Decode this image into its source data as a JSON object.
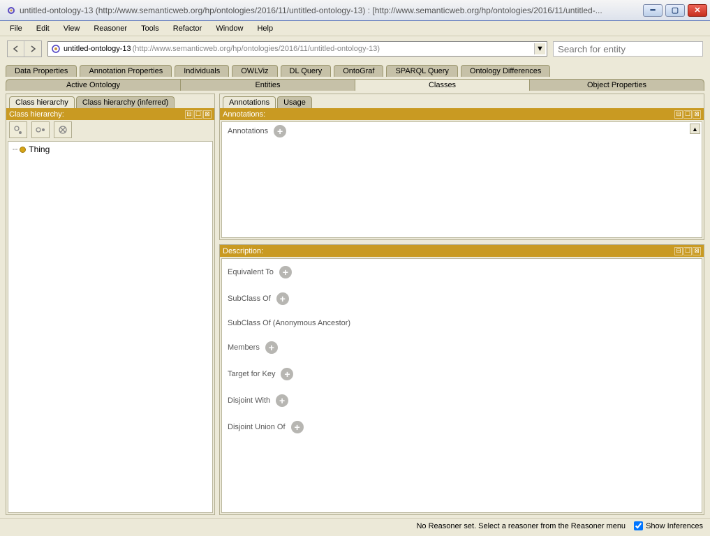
{
  "window": {
    "title": "untitled-ontology-13 (http://www.semanticweb.org/hp/ontologies/2016/11/untitled-ontology-13)  :  [http://www.semanticweb.org/hp/ontologies/2016/11/untitled-..."
  },
  "menu": {
    "items": [
      "File",
      "Edit",
      "View",
      "Reasoner",
      "Tools",
      "Refactor",
      "Window",
      "Help"
    ]
  },
  "toolbar": {
    "ontology_main": "untitled-ontology-13",
    "ontology_sub": "(http://www.semanticweb.org/hp/ontologies/2016/11/untitled-ontology-13)",
    "search_placeholder": "Search for entity"
  },
  "tabs_row1": [
    "Data Properties",
    "Annotation Properties",
    "Individuals",
    "OWLViz",
    "DL Query",
    "OntoGraf",
    "SPARQL Query",
    "Ontology Differences"
  ],
  "tabs_row2": [
    {
      "label": "Active Ontology",
      "active": false
    },
    {
      "label": "Entities",
      "active": false
    },
    {
      "label": "Classes",
      "active": true
    },
    {
      "label": "Object Properties",
      "active": false
    }
  ],
  "left": {
    "subtabs": [
      {
        "label": "Class hierarchy",
        "active": true
      },
      {
        "label": "Class hierarchy (inferred)",
        "active": false
      }
    ],
    "section_title": "Class hierarchy:",
    "tree": {
      "root": "Thing"
    }
  },
  "right": {
    "subtabs": [
      {
        "label": "Annotations",
        "active": true
      },
      {
        "label": "Usage",
        "active": false
      }
    ],
    "annotations": {
      "section_title": "Annotations:",
      "label": "Annotations"
    },
    "description": {
      "section_title": "Description:",
      "items": [
        {
          "label": "Equivalent To",
          "plus": true
        },
        {
          "label": "SubClass Of",
          "plus": true
        },
        {
          "label": "SubClass Of (Anonymous Ancestor)",
          "plus": false
        },
        {
          "label": "Members",
          "plus": true
        },
        {
          "label": "Target for Key",
          "plus": true
        },
        {
          "label": "Disjoint With",
          "plus": true
        },
        {
          "label": "Disjoint Union Of",
          "plus": true
        }
      ]
    }
  },
  "statusbar": {
    "message": "No Reasoner set. Select a reasoner from the Reasoner menu",
    "checkbox_label": "Show Inferences",
    "checkbox_checked": true
  }
}
